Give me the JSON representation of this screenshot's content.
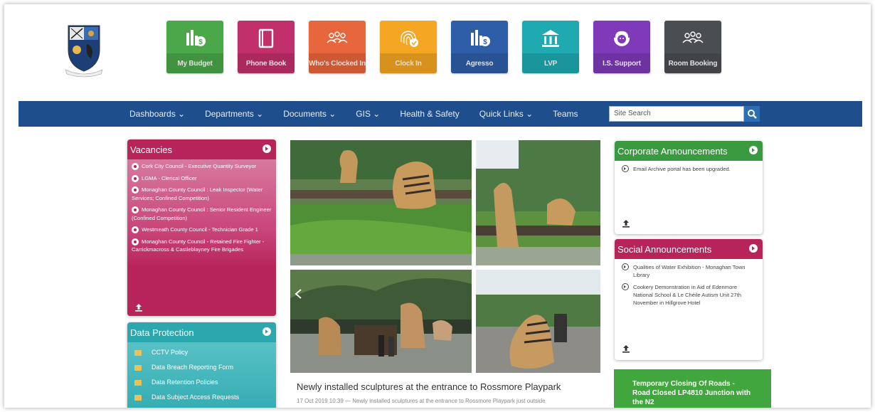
{
  "tiles": [
    {
      "label": "My Budget",
      "color": "#4aa84a",
      "icon": "budget-icon"
    },
    {
      "label": "Phone Book",
      "color": "#c2306c",
      "icon": "phone-book-icon"
    },
    {
      "label": "Who's Clocked In",
      "color": "#e8663b",
      "icon": "people-icon"
    },
    {
      "label": "Clock In",
      "color": "#f5a623",
      "icon": "fingerprint-icon"
    },
    {
      "label": "Agresso",
      "color": "#2f5ea8",
      "icon": "budget-icon"
    },
    {
      "label": "LVP",
      "color": "#1faab2",
      "icon": "bank-icon"
    },
    {
      "label": "I.S. Support",
      "color": "#7e3ab8",
      "icon": "support-icon"
    },
    {
      "label": "Room Booking",
      "color": "#4a4d52",
      "icon": "people-icon"
    }
  ],
  "nav": {
    "items": [
      "Dashboards ⌄",
      "Departments ⌄",
      "Documents ⌄",
      "GIS ⌄",
      "Health & Safety",
      "Quick Links ⌄",
      "Teams"
    ],
    "search_placeholder": "Site Search"
  },
  "vacancies": {
    "title": "Vacancies",
    "items": [
      "Cork City Council - Executive Quantity Surveyor",
      "LGMA - Clerical Officer",
      "Monaghan County Council : Leak Inspector (Water Services; Confined Competition)",
      "Monaghan County Council : Senior Resident Engineer (Confined Competition)",
      "Westmeath County Council - Technician Grade 1",
      "Monaghan County Council - Retained Fire Fighter - Carrickmacross & Castleblayney Fire Brigades"
    ]
  },
  "data_protection": {
    "title": "Data Protection",
    "items": [
      "CCTV Policy",
      "Data Breach Reporting Form",
      "Data Retention Policies",
      "Data Subject Access Requests"
    ]
  },
  "news": {
    "title": "Newly installed sculptures at the entrance to Rossmore Playpark",
    "snippet": "17 Oct 2019 10:39 — Newly installed sculptures at the entrance to Rossmore Playpark just outside"
  },
  "corporate": {
    "title": "Corporate Announcements",
    "items": [
      "Email Archive portal has been upgraded."
    ]
  },
  "social": {
    "title": "Social Announcements",
    "items": [
      "Qualities of Water Exhibition - Monaghan Town Library",
      "Cookery Demonstration in Aid of Edenmore National School & Le Chéile Autism Unit 27th November in Hillgrove Hotel"
    ]
  },
  "road_notice": {
    "line1": "Temporary Closing Of Roads -",
    "line2": "Road Closed LP4810 Junction with",
    "line3": "the N2"
  }
}
